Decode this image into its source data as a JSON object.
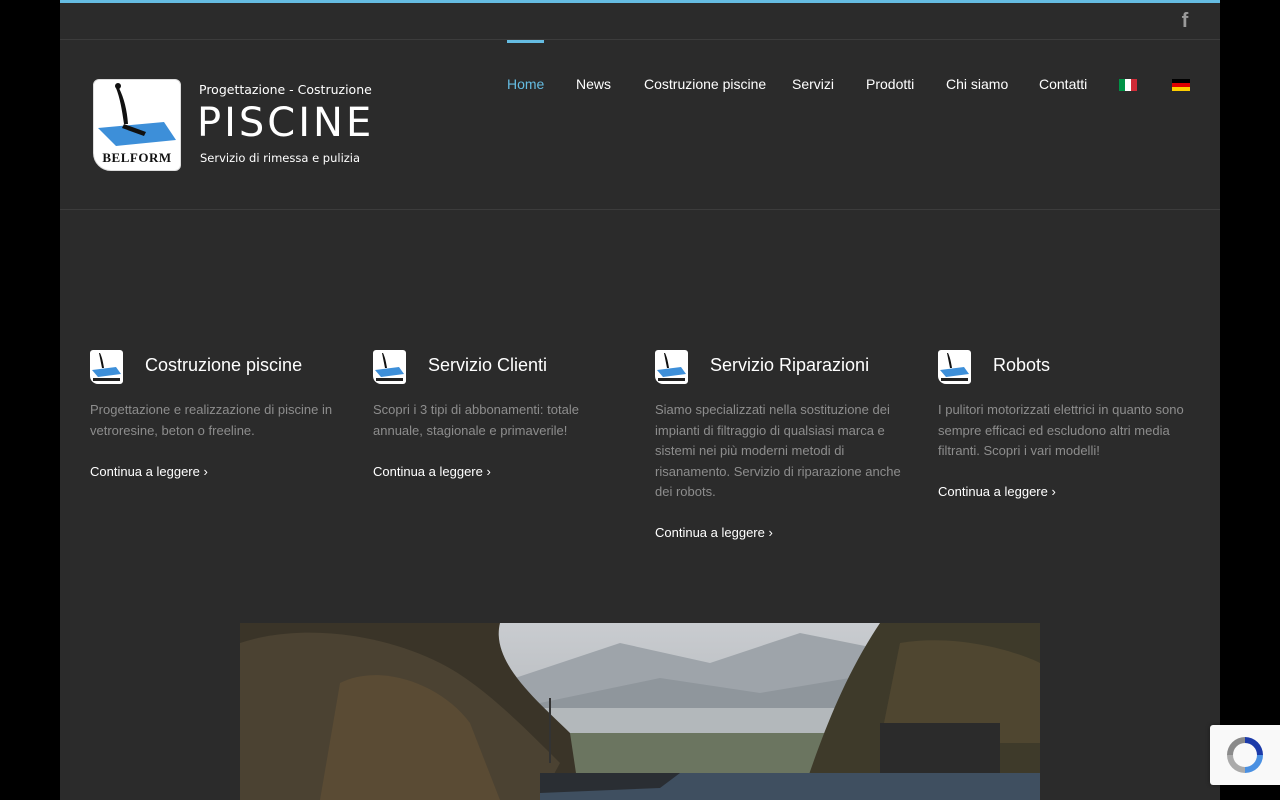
{
  "social": {
    "facebook_glyph": "f",
    "icon": "facebook-icon"
  },
  "logo": {
    "top_line": "Progettazione - Costruzione",
    "main": "PISCINE",
    "sub": "Servizio di rimessa e pulizia",
    "brand": "BELFORM"
  },
  "nav": {
    "items": [
      {
        "label": "Home",
        "active": true
      },
      {
        "label": "News"
      },
      {
        "label": "Costruzione piscine"
      },
      {
        "label": "Servizi"
      },
      {
        "label": "Prodotti"
      },
      {
        "label": "Chi siamo"
      },
      {
        "label": "Contatti"
      }
    ],
    "languages": [
      {
        "code": "it",
        "icon": "italy-flag-icon",
        "colors": [
          "#009246",
          "#ffffff",
          "#ce2b37"
        ]
      },
      {
        "code": "de",
        "icon": "germany-flag-icon",
        "colors": [
          "#000000",
          "#dd0000",
          "#ffce00"
        ]
      }
    ]
  },
  "features": [
    {
      "title": "Costruzione piscine",
      "text": "Progettazione e realizzazione di piscine in vetroresine, beton o freeline.",
      "link": "Continua a leggere ›"
    },
    {
      "title": "Servizio Clienti",
      "text": "Scopri i 3 tipi di abbonamenti: totale annuale, stagionale e primaverile!",
      "link": "Continua a leggere ›"
    },
    {
      "title": "Servizio Riparazioni",
      "text": "Siamo specializzati nella sostituzione dei impianti di filtraggio di qualsiasi marca e sistemi nei più moderni metodi di risanamento. Servizio di riparazione anche dei robots.",
      "link": "Continua a leggere ›"
    },
    {
      "title": "Robots",
      "text": "I pulitori motorizzati elettrici in quanto sono sempre efficaci ed escludono altri media filtranti. Scopri i vari modelli!",
      "link": "Continua a leggere ›"
    }
  ],
  "colors": {
    "accent": "#65bce2",
    "background": "#2b2b2b",
    "body_text": "#8d8d8d"
  }
}
